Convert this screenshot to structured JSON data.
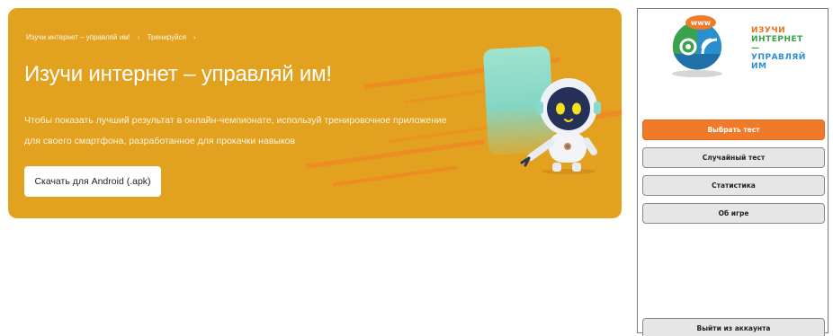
{
  "banner": {
    "breadcrumb": [
      "Изучи интернет – управляй им!",
      "Тренируйся"
    ],
    "breadcrumb_separator": "›",
    "title": "Изучи интернет – управляй им!",
    "description": "Чтобы показать лучший результат в онлайн-чемпионате, используй тренировочное приложение для своего смартфона, разработанное для прокачки навыков",
    "download_button": "Скачать для Android (.apk)",
    "background_color": "#e2a21f",
    "stripe_color": "#ee8a24"
  },
  "app": {
    "logo": {
      "badge_text": "www",
      "line1": "ИЗУЧИ",
      "line2": "ИНТЕРНЕТ —",
      "line3": "УПРАВЛЯЙ ИМ"
    },
    "menu": {
      "choose_test": "Выбрать тест",
      "random_test": "Случайный тест",
      "statistics": "Статистика",
      "about": "Об игре"
    },
    "logout": "Выйти из аккаунта",
    "accent_color": "#f07a28"
  }
}
